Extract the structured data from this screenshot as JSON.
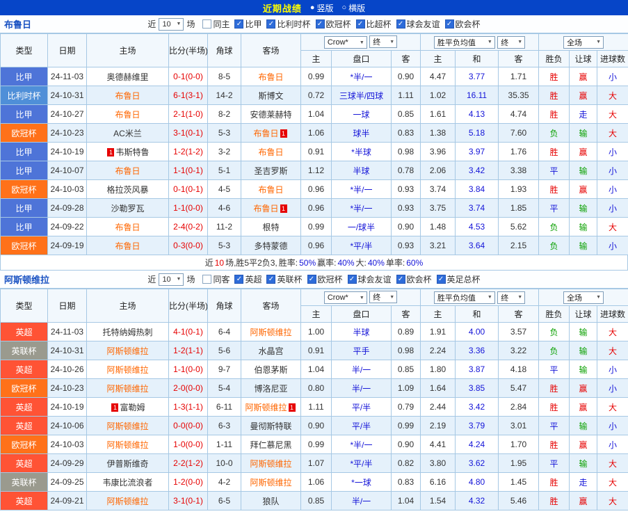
{
  "topbar": {
    "title": "近期战绩",
    "layout_options": [
      {
        "label": "竖版",
        "selected": true
      },
      {
        "label": "横版",
        "selected": false
      }
    ]
  },
  "league_colors": {
    "比甲": "#4e74d8",
    "比利时杯": "#4f8fd8",
    "欧冠杯": "#ff7119",
    "英超": "#ff5335",
    "英联杯": "#9a9a8e"
  },
  "result_colors": {
    "胜": "#e60000",
    "平": "#1414d8",
    "负": "#0aa000",
    "赢": "#e60000",
    "走": "#1414d8",
    "输": "#0aa000",
    "大": "#e60000",
    "小": "#1414d8"
  },
  "sections": [
    {
      "team": "布鲁日",
      "filter": {
        "near_label": "近",
        "count": "10",
        "games_label": "场",
        "same_checkbox": {
          "label": "同主",
          "checked": false
        },
        "league_checkboxes": [
          {
            "label": "比甲",
            "checked": true
          },
          {
            "label": "比利时杯",
            "checked": true
          },
          {
            "label": "欧冠杯",
            "checked": true
          },
          {
            "label": "比超杯",
            "checked": true
          },
          {
            "label": "球会友谊",
            "checked": true
          },
          {
            "label": "欧会杯",
            "checked": true
          }
        ]
      },
      "table": {
        "headers": {
          "type": "类型",
          "date": "日期",
          "home": "主场",
          "score": "比分(半场)",
          "corner": "角球",
          "away": "客场",
          "odds_select": "Crow*",
          "odds_final": "终",
          "avg_select": "胜平负均值",
          "avg_final": "终",
          "scope_select": "全场",
          "odds_sub": [
            "主",
            "盘口",
            "客"
          ],
          "avg_sub": [
            "主",
            "和",
            "客"
          ],
          "result_sub": [
            "胜负",
            "让球",
            "进球数"
          ]
        },
        "rows": [
          {
            "league": "比甲",
            "date": "24-11-03",
            "home": "奥德赫维里",
            "home_subject": false,
            "home_badge": "",
            "score": "0-1(0-0)",
            "corner": "8-5",
            "away": "布鲁日",
            "away_subject": true,
            "away_badge": "",
            "h1": "0.99",
            "handicap": "*半/一",
            "h2": "0.90",
            "e1": "4.47",
            "e2": "3.77",
            "e3": "1.71",
            "result": "胜",
            "cover": "赢",
            "ou": "小"
          },
          {
            "league": "比利时杯",
            "date": "24-10-31",
            "home": "布鲁日",
            "home_subject": true,
            "home_badge": "",
            "score": "6-1(3-1)",
            "corner": "14-2",
            "away": "斯博文",
            "away_subject": false,
            "away_badge": "",
            "h1": "0.72",
            "handicap": "三球半/四球",
            "h2": "1.11",
            "e1": "1.02",
            "e2": "16.11",
            "e3": "35.35",
            "result": "胜",
            "cover": "赢",
            "ou": "大"
          },
          {
            "league": "比甲",
            "date": "24-10-27",
            "home": "布鲁日",
            "home_subject": true,
            "home_badge": "",
            "score": "2-1(1-0)",
            "corner": "8-2",
            "away": "安德莱赫特",
            "away_subject": false,
            "away_badge": "",
            "h1": "1.04",
            "handicap": "一球",
            "h2": "0.85",
            "e1": "1.61",
            "e2": "4.13",
            "e3": "4.74",
            "result": "胜",
            "cover": "走",
            "ou": "大"
          },
          {
            "league": "欧冠杯",
            "date": "24-10-23",
            "home": "AC米兰",
            "home_subject": false,
            "home_badge": "",
            "score": "3-1(0-1)",
            "corner": "5-3",
            "away": "布鲁日",
            "away_subject": true,
            "away_badge": "1",
            "h1": "1.06",
            "handicap": "球半",
            "h2": "0.83",
            "e1": "1.38",
            "e2": "5.18",
            "e3": "7.60",
            "result": "负",
            "cover": "输",
            "ou": "大"
          },
          {
            "league": "比甲",
            "date": "24-10-19",
            "home": "韦斯特鲁",
            "home_subject": false,
            "home_badge": "1",
            "score": "1-2(1-2)",
            "corner": "3-2",
            "away": "布鲁日",
            "away_subject": true,
            "away_badge": "",
            "h1": "0.91",
            "handicap": "*半球",
            "h2": "0.98",
            "e1": "3.96",
            "e2": "3.97",
            "e3": "1.76",
            "result": "胜",
            "cover": "赢",
            "ou": "小"
          },
          {
            "league": "比甲",
            "date": "24-10-07",
            "home": "布鲁日",
            "home_subject": true,
            "home_badge": "",
            "score": "1-1(0-1)",
            "corner": "5-1",
            "away": "圣吉罗斯",
            "away_subject": false,
            "away_badge": "",
            "h1": "1.12",
            "handicap": "半球",
            "h2": "0.78",
            "e1": "2.06",
            "e2": "3.42",
            "e3": "3.38",
            "result": "平",
            "cover": "输",
            "ou": "小"
          },
          {
            "league": "欧冠杯",
            "date": "24-10-03",
            "home": "格拉茨风暴",
            "home_subject": false,
            "home_badge": "",
            "score": "0-1(0-1)",
            "corner": "4-5",
            "away": "布鲁日",
            "away_subject": true,
            "away_badge": "",
            "h1": "0.96",
            "handicap": "*半/一",
            "h2": "0.93",
            "e1": "3.74",
            "e2": "3.84",
            "e3": "1.93",
            "result": "胜",
            "cover": "赢",
            "ou": "小"
          },
          {
            "league": "比甲",
            "date": "24-09-28",
            "home": "沙勒罗瓦",
            "home_subject": false,
            "home_badge": "",
            "score": "1-1(0-0)",
            "corner": "4-6",
            "away": "布鲁日",
            "away_subject": true,
            "away_badge": "1",
            "h1": "0.96",
            "handicap": "*半/一",
            "h2": "0.93",
            "e1": "3.75",
            "e2": "3.74",
            "e3": "1.85",
            "result": "平",
            "cover": "输",
            "ou": "小"
          },
          {
            "league": "比甲",
            "date": "24-09-22",
            "home": "布鲁日",
            "home_subject": true,
            "home_badge": "",
            "score": "2-4(0-2)",
            "corner": "11-2",
            "away": "根特",
            "away_subject": false,
            "away_badge": "",
            "h1": "0.99",
            "handicap": "一/球半",
            "h2": "0.90",
            "e1": "1.48",
            "e2": "4.53",
            "e3": "5.62",
            "result": "负",
            "cover": "输",
            "ou": "大"
          },
          {
            "league": "欧冠杯",
            "date": "24-09-19",
            "home": "布鲁日",
            "home_subject": true,
            "home_badge": "",
            "score": "0-3(0-0)",
            "corner": "5-3",
            "away": "多特蒙德",
            "away_subject": false,
            "away_badge": "",
            "h1": "0.96",
            "handicap": "*平/半",
            "h2": "0.93",
            "e1": "3.21",
            "e2": "3.64",
            "e3": "2.15",
            "result": "负",
            "cover": "输",
            "ou": "小"
          }
        ],
        "summary_parts": [
          {
            "text": "近",
            "color": "#333333"
          },
          {
            "text": "10",
            "color": "#e60000"
          },
          {
            "text": "场,胜5平2负3, ",
            "color": "#333333"
          },
          {
            "text": "胜率:",
            "color": "#333333"
          },
          {
            "text": "50%",
            "color": "#1414d8"
          },
          {
            "text": " 赢率:",
            "color": "#333333"
          },
          {
            "text": "40%",
            "color": "#1414d8"
          },
          {
            "text": " 大:",
            "color": "#333333"
          },
          {
            "text": "40%",
            "color": "#1414d8"
          },
          {
            "text": " 单率:",
            "color": "#333333"
          },
          {
            "text": "60%",
            "color": "#1414d8"
          }
        ]
      }
    },
    {
      "team": "阿斯顿维拉",
      "filter": {
        "near_label": "近",
        "count": "10",
        "games_label": "场",
        "same_checkbox": {
          "label": "同客",
          "checked": false
        },
        "league_checkboxes": [
          {
            "label": "英超",
            "checked": true
          },
          {
            "label": "英联杯",
            "checked": true
          },
          {
            "label": "欧冠杯",
            "checked": true
          },
          {
            "label": "球会友谊",
            "checked": true
          },
          {
            "label": "欧会杯",
            "checked": true
          },
          {
            "label": "英足总杯",
            "checked": true
          }
        ]
      },
      "table": {
        "headers": {
          "type": "类型",
          "date": "日期",
          "home": "主场",
          "score": "比分(半场)",
          "corner": "角球",
          "away": "客场",
          "odds_select": "Crow*",
          "odds_final": "终",
          "avg_select": "胜平负均值",
          "avg_final": "终",
          "scope_select": "全场",
          "odds_sub": [
            "主",
            "盘口",
            "客"
          ],
          "avg_sub": [
            "主",
            "和",
            "客"
          ],
          "result_sub": [
            "胜负",
            "让球",
            "进球数"
          ]
        },
        "rows": [
          {
            "league": "英超",
            "date": "24-11-03",
            "home": "托特纳姆热刺",
            "home_subject": false,
            "home_badge": "",
            "score": "4-1(0-1)",
            "corner": "6-4",
            "away": "阿斯顿维拉",
            "away_subject": true,
            "away_badge": "",
            "h1": "1.00",
            "handicap": "半球",
            "h2": "0.89",
            "e1": "1.91",
            "e2": "4.00",
            "e3": "3.57",
            "result": "负",
            "cover": "输",
            "ou": "大"
          },
          {
            "league": "英联杯",
            "date": "24-10-31",
            "home": "阿斯顿维拉",
            "home_subject": true,
            "home_badge": "",
            "score": "1-2(1-1)",
            "corner": "5-6",
            "away": "水晶宫",
            "away_subject": false,
            "away_badge": "",
            "h1": "0.91",
            "handicap": "平手",
            "h2": "0.98",
            "e1": "2.24",
            "e2": "3.36",
            "e3": "3.22",
            "result": "负",
            "cover": "输",
            "ou": "大"
          },
          {
            "league": "英超",
            "date": "24-10-26",
            "home": "阿斯顿维拉",
            "home_subject": true,
            "home_badge": "",
            "score": "1-1(0-0)",
            "corner": "9-7",
            "away": "伯恩茅斯",
            "away_subject": false,
            "away_badge": "",
            "h1": "1.04",
            "handicap": "半/一",
            "h2": "0.85",
            "e1": "1.80",
            "e2": "3.87",
            "e3": "4.18",
            "result": "平",
            "cover": "输",
            "ou": "小"
          },
          {
            "league": "欧冠杯",
            "date": "24-10-23",
            "home": "阿斯顿维拉",
            "home_subject": true,
            "home_badge": "",
            "score": "2-0(0-0)",
            "corner": "5-4",
            "away": "博洛尼亚",
            "away_subject": false,
            "away_badge": "",
            "h1": "0.80",
            "handicap": "半/一",
            "h2": "1.09",
            "e1": "1.64",
            "e2": "3.85",
            "e3": "5.47",
            "result": "胜",
            "cover": "赢",
            "ou": "小"
          },
          {
            "league": "英超",
            "date": "24-10-19",
            "home": "富勒姆",
            "home_subject": false,
            "home_badge": "1",
            "score": "1-3(1-1)",
            "corner": "6-11",
            "away": "阿斯顿维拉",
            "away_subject": true,
            "away_badge": "1",
            "h1": "1.11",
            "handicap": "平/半",
            "h2": "0.79",
            "e1": "2.44",
            "e2": "3.42",
            "e3": "2.84",
            "result": "胜",
            "cover": "赢",
            "ou": "大"
          },
          {
            "league": "英超",
            "date": "24-10-06",
            "home": "阿斯顿维拉",
            "home_subject": true,
            "home_badge": "",
            "score": "0-0(0-0)",
            "corner": "6-3",
            "away": "曼彻斯特联",
            "away_subject": false,
            "away_badge": "",
            "h1": "0.90",
            "handicap": "平/半",
            "h2": "0.99",
            "e1": "2.19",
            "e2": "3.79",
            "e3": "3.01",
            "result": "平",
            "cover": "输",
            "ou": "小"
          },
          {
            "league": "欧冠杯",
            "date": "24-10-03",
            "home": "阿斯顿维拉",
            "home_subject": true,
            "home_badge": "",
            "score": "1-0(0-0)",
            "corner": "1-11",
            "away": "拜仁慕尼黑",
            "away_subject": false,
            "away_badge": "",
            "h1": "0.99",
            "handicap": "*半/一",
            "h2": "0.90",
            "e1": "4.41",
            "e2": "4.24",
            "e3": "1.70",
            "result": "胜",
            "cover": "赢",
            "ou": "小"
          },
          {
            "league": "英超",
            "date": "24-09-29",
            "home": "伊普斯维奇",
            "home_subject": false,
            "home_badge": "",
            "score": "2-2(1-2)",
            "corner": "10-0",
            "away": "阿斯顿维拉",
            "away_subject": true,
            "away_badge": "",
            "h1": "1.07",
            "handicap": "*平/半",
            "h2": "0.82",
            "e1": "3.80",
            "e2": "3.62",
            "e3": "1.95",
            "result": "平",
            "cover": "输",
            "ou": "大"
          },
          {
            "league": "英联杯",
            "date": "24-09-25",
            "home": "韦康比流浪者",
            "home_subject": false,
            "home_badge": "",
            "score": "1-2(0-0)",
            "corner": "4-2",
            "away": "阿斯顿维拉",
            "away_subject": true,
            "away_badge": "",
            "h1": "1.06",
            "handicap": "*一球",
            "h2": "0.83",
            "e1": "6.16",
            "e2": "4.80",
            "e3": "1.45",
            "result": "胜",
            "cover": "走",
            "ou": "大"
          },
          {
            "league": "英超",
            "date": "24-09-21",
            "home": "阿斯顿维拉",
            "home_subject": true,
            "home_badge": "",
            "score": "3-1(0-1)",
            "corner": "6-5",
            "away": "狼队",
            "away_subject": false,
            "away_badge": "",
            "h1": "0.85",
            "handicap": "半/一",
            "h2": "1.04",
            "e1": "1.54",
            "e2": "4.32",
            "e3": "5.46",
            "result": "胜",
            "cover": "赢",
            "ou": "大"
          }
        ]
      }
    }
  ]
}
